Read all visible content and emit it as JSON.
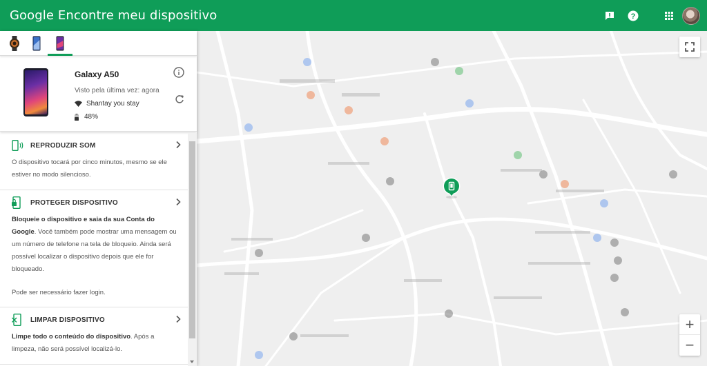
{
  "header": {
    "title": "Google Encontre meu dispositivo",
    "bg_color": "#0f9d58"
  },
  "tabs": [
    {
      "icon": "smartwatch-icon",
      "active": false
    },
    {
      "icon": "phone-blue-icon",
      "active": false
    },
    {
      "icon": "phone-galaxy-icon",
      "active": true
    }
  ],
  "device": {
    "name": "Galaxy A50",
    "last_seen": "Visto pela última vez: agora",
    "wifi": "Shantay you stay",
    "battery": "48%"
  },
  "actions": {
    "sound": {
      "title": "REPRODUZIR SOM",
      "desc": "O dispositivo tocará por cinco minutos, mesmo se ele estiver no modo silencioso."
    },
    "protect": {
      "title": "PROTEGER DISPOSITIVO",
      "desc_bold": "Bloqueie o dispositivo e saia da sua Conta do Google",
      "desc_rest": ". Você também pode mostrar uma mensagem ou um número de telefone na tela de bloqueio. Ainda será possível localizar o dispositivo depois que ele for bloqueado.",
      "note": "Pode ser necessário fazer login."
    },
    "erase": {
      "title": "LIMPAR DISPOSITIVO",
      "desc_bold": "Limpe todo o conteúdo do dispositivo",
      "desc_rest": ". Após a limpeza, não será possível localizá-lo."
    }
  },
  "map": {
    "zoom_in": "+",
    "zoom_out": "−"
  }
}
